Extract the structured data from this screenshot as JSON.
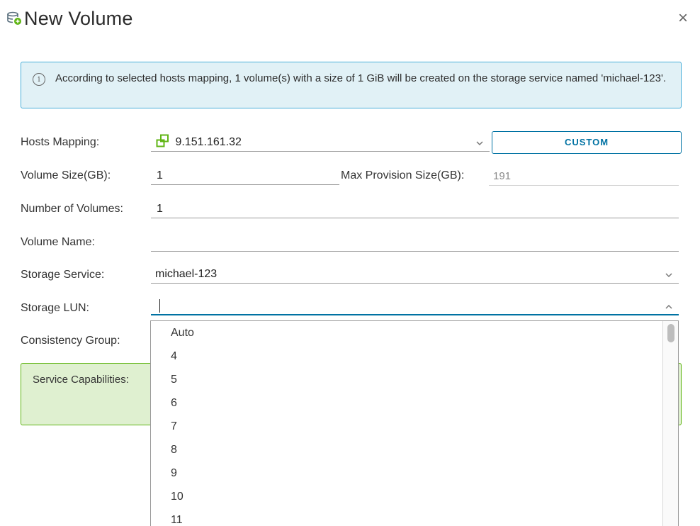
{
  "dialog": {
    "title": "New Volume",
    "title_icon": "storage-volume-icon",
    "close_icon": "close-icon",
    "close_glyph": "×"
  },
  "info_alert": {
    "icon": "info-icon",
    "icon_glyph": "i",
    "text": "According to selected hosts mapping, 1 volume(s) with a size of 1 GiB will be created on the storage service named 'michael-123'."
  },
  "form": {
    "hosts_mapping": {
      "label": "Hosts Mapping:",
      "value": "9.151.161.32",
      "icon": "host-cluster-icon",
      "custom_button": "CUSTOM"
    },
    "volume_size": {
      "label": "Volume Size(GB):",
      "value": "1",
      "max_label": "Max Provision Size(GB):",
      "max_value": "191"
    },
    "number_of_volumes": {
      "label": "Number of Volumes:",
      "value": "1"
    },
    "volume_name": {
      "label": "Volume Name:",
      "value": ""
    },
    "storage_service": {
      "label": "Storage Service:",
      "value": "michael-123"
    },
    "storage_lun": {
      "label": "Storage LUN:",
      "value": "",
      "options": [
        "Auto",
        "4",
        "5",
        "6",
        "7",
        "8",
        "9",
        "10",
        "11"
      ]
    },
    "consistency_group": {
      "label": "Consistency Group:"
    },
    "service_capabilities": {
      "label": "Service Capabilities:"
    }
  },
  "colors": {
    "accent": "#0072a3",
    "info_bg": "#e1f1f6",
    "info_border": "#49afd9",
    "success_bg": "#dff0d0",
    "success_border": "#60b515",
    "host_icon": "#60b515"
  }
}
